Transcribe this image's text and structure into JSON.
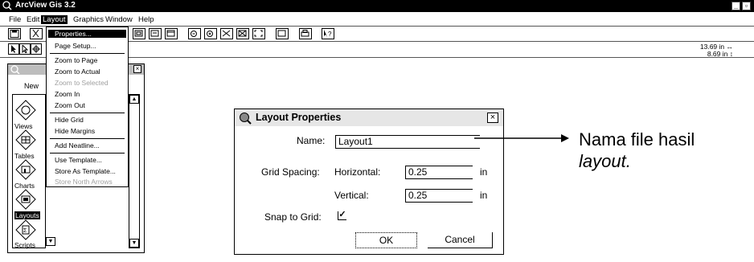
{
  "app": {
    "title": "ArcView Gis 3.2"
  },
  "menubar": {
    "file": "File",
    "edit": "Edit",
    "layout": "Layout",
    "graphics": "Graphics",
    "window": "Window",
    "help": "Help"
  },
  "layout_menu": {
    "items": [
      {
        "label": "Properties...",
        "state": "highlighted"
      },
      {
        "label": "Page Setup...",
        "state": "enabled"
      },
      {
        "label": "Zoom to Page",
        "state": "enabled"
      },
      {
        "label": "Zoom to Actual",
        "state": "enabled"
      },
      {
        "label": "Zoom to Selected",
        "state": "disabled"
      },
      {
        "label": "Zoom In",
        "state": "enabled"
      },
      {
        "label": "Zoom Out",
        "state": "enabled"
      },
      {
        "label": "Hide Grid",
        "state": "enabled"
      },
      {
        "label": "Hide Margins",
        "state": "enabled"
      },
      {
        "label": "Add Neatline...",
        "state": "enabled"
      },
      {
        "label": "Use Template...",
        "state": "enabled"
      },
      {
        "label": "Store As Template...",
        "state": "enabled"
      },
      {
        "label": "Store North Arrows",
        "state": "disabled"
      }
    ]
  },
  "coords": {
    "x": "13.69 in",
    "y": "8.69 in"
  },
  "project": {
    "new_label": "New",
    "docs": [
      {
        "label": "Views",
        "icon": "views-icon"
      },
      {
        "label": "Tables",
        "icon": "tables-icon"
      },
      {
        "label": "Charts",
        "icon": "charts-icon"
      },
      {
        "label": "Layouts",
        "icon": "layouts-icon",
        "selected": true
      },
      {
        "label": "Scripts",
        "icon": "scripts-icon"
      }
    ]
  },
  "dialog": {
    "title": "Layout Properties",
    "name_label": "Name:",
    "name_value": "Layout1",
    "grid_label": "Grid Spacing:",
    "horizontal_label": "Horizontal:",
    "horizontal_value": "0.25",
    "horizontal_unit": "in",
    "vertical_label": "Vertical:",
    "vertical_value": "0.25",
    "vertical_unit": "in",
    "snap_label": "Snap to Grid:",
    "snap_checked": true,
    "ok_label": "OK",
    "cancel_label": "Cancel"
  },
  "annotation": {
    "line1": "Nama file hasil",
    "line2": "layout."
  }
}
